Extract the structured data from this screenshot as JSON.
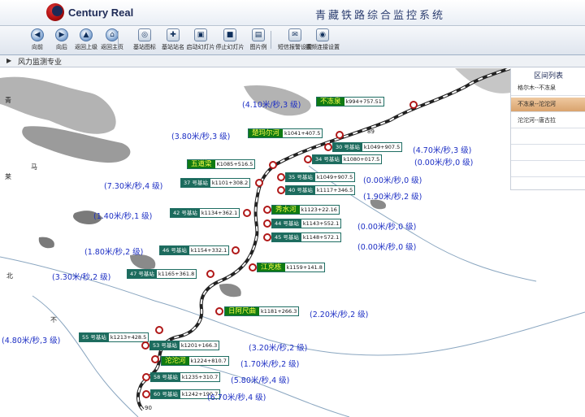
{
  "header": {
    "brand": "Century Real",
    "title": "青藏铁路综合监控系统"
  },
  "toolbar": [
    {
      "label": "向前",
      "icon": "arrow-left-icon",
      "glyph": "◀"
    },
    {
      "label": "向后",
      "icon": "arrow-right-icon",
      "glyph": "▶"
    },
    {
      "label": "返回上级",
      "icon": "arrow-up-icon",
      "glyph": "▲"
    },
    {
      "label": "返回主页",
      "icon": "home-icon",
      "glyph": "⌂"
    },
    {
      "label": "基站图标",
      "icon": "station-icon",
      "glyph": "◎"
    },
    {
      "label": "基站站名",
      "icon": "station-name-icon",
      "glyph": "✚"
    },
    {
      "label": "启动幻灯片",
      "icon": "slideshow-start-icon",
      "glyph": "▣"
    },
    {
      "label": "停止幻灯片",
      "icon": "slideshow-stop-icon",
      "glyph": "■"
    },
    {
      "label": "图片例",
      "icon": "picture-legend-icon",
      "glyph": "▤"
    },
    {
      "label": "短信报警设置",
      "icon": "sms-alarm-icon",
      "glyph": "✉"
    },
    {
      "label": "视频连接设置",
      "icon": "video-link-icon",
      "glyph": "◉"
    }
  ],
  "breadcrumb": {
    "text": "风力监测专业"
  },
  "panel": {
    "title": "区间列表",
    "items": [
      {
        "label": "格尔木--不冻泉",
        "selected": false
      },
      {
        "label": "不冻泉--沱沱河",
        "selected": true
      },
      {
        "label": "沱沱河--唐古拉",
        "selected": false
      }
    ]
  },
  "map": {
    "region_labels": [
      "青",
      "马",
      "莱",
      "北",
      "不"
    ],
    "km_ticks": [
      "89",
      "90"
    ],
    "stations": [
      {
        "name": "不冻泉",
        "km": "k994+757.51",
        "major": true,
        "wind": "(4.10米/秒,3 级)"
      },
      {
        "name": "楚玛尔河",
        "km": "k1041+407.5",
        "major": true,
        "wind": "(3.80米/秒,3 级)"
      },
      {
        "name": "30 号基站",
        "km": "k1049+907.5",
        "major": false,
        "wind": "(4.70米/秒,3 级)"
      },
      {
        "name": "34 号基站",
        "km": "k1080+017.5",
        "major": false,
        "wind": "(0.00米/秒,0 级)"
      },
      {
        "name": "五道梁",
        "km": "K1085+516.5",
        "major": true,
        "wind": ""
      },
      {
        "name": "35 号基站",
        "km": "k1049+907.5",
        "major": false,
        "wind": "(0.00米/秒,0 级)"
      },
      {
        "name": "37 号基站",
        "km": "k1101+308.2",
        "major": false,
        "wind": "(7.30米/秒,4 级)"
      },
      {
        "name": "40 号基站",
        "km": "k1117+346.5",
        "major": false,
        "wind": "(1.90米/秒,2 级)"
      },
      {
        "name": "秀水河",
        "km": "k1123+22.16",
        "major": true,
        "wind": ""
      },
      {
        "name": "42 号基站",
        "km": "k1134+362.1",
        "major": false,
        "wind": "(1.40米/秒,1 级)"
      },
      {
        "name": "44 号基站",
        "km": "k1143+552.1",
        "major": false,
        "wind": "(0.00米/秒,0 级)"
      },
      {
        "name": "45 号基站",
        "km": "k1148+572.1",
        "major": false,
        "wind": "(0.00米/秒,0 级)"
      },
      {
        "name": "46 号基站",
        "km": "k1154+332.1",
        "major": false,
        "wind": "(1.80米/秒,2 级)"
      },
      {
        "name": "江克栋",
        "km": "k1159+141.8",
        "major": true,
        "wind": ""
      },
      {
        "name": "47 号基站",
        "km": "k1165+361.8",
        "major": false,
        "wind": "(3.30米/秒,2 级)"
      },
      {
        "name": "日阿尺曲",
        "km": "k1181+266.3",
        "major": true,
        "wind": "(2.20米/秒,2 级)"
      },
      {
        "name": "55 号基站",
        "km": "k1213+428.5",
        "major": false,
        "wind": "(4.80米/秒,3 级)"
      },
      {
        "name": "53 号基站",
        "km": "k1201+166.3",
        "major": false,
        "wind": "(3.20米/秒,2 级)"
      },
      {
        "name": "沱沱河",
        "km": "k1224+810.7",
        "major": true,
        "wind": "(1.70米/秒,2 级)"
      },
      {
        "name": "58 号基站",
        "km": "k1235+310.7",
        "major": false,
        "wind": "(5.80米/秒,4 级)"
      },
      {
        "name": "60 号基站",
        "km": "k1242+190.7",
        "major": false,
        "wind": "(6.70米/秒,4 级)"
      }
    ]
  },
  "colors": {
    "station_major": "#0f7a12",
    "station_minor": "#1c6b5d",
    "wind_text": "#1c2ec4",
    "alarm_ring": "#b01818"
  }
}
